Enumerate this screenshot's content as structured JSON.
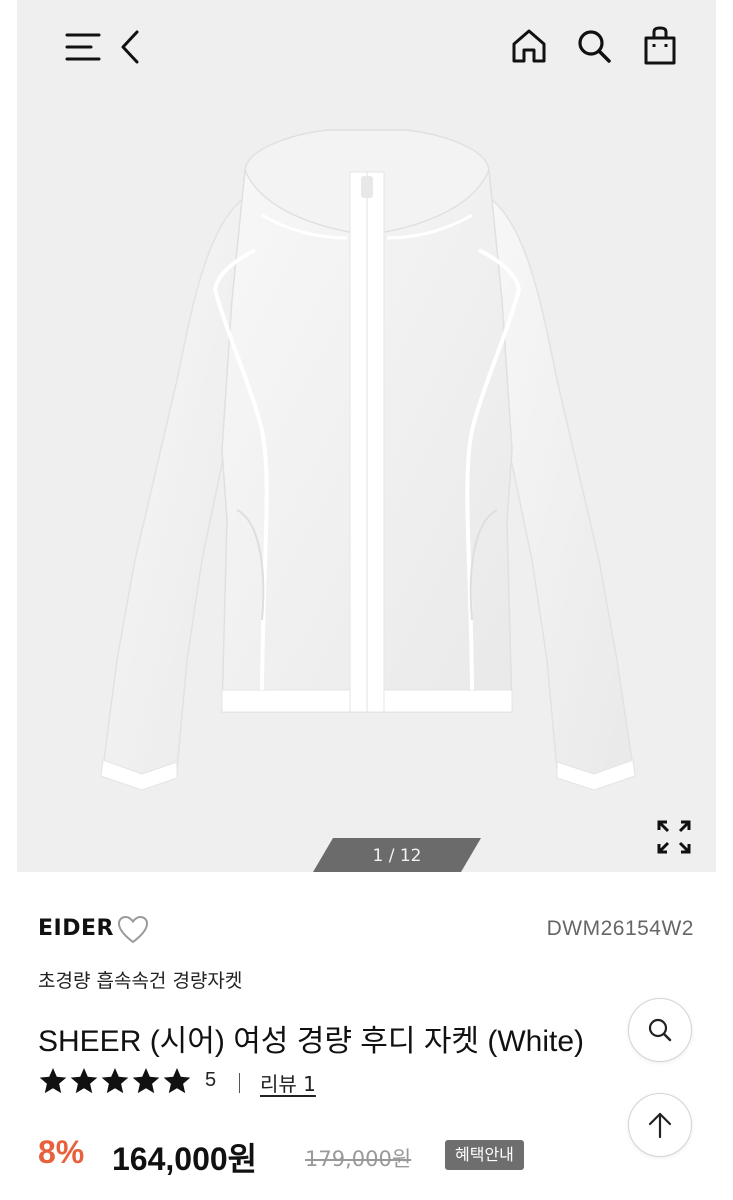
{
  "gallery": {
    "counter": "1 / 12",
    "current_page": 1,
    "total_pages": 12
  },
  "topbar": {
    "icons": [
      "menu-icon",
      "back-arrow-icon",
      "home-icon",
      "search-icon",
      "shopping-bag-icon"
    ]
  },
  "product": {
    "brand": "EIDER",
    "code": "DWM26154W2",
    "subtitle": "초경량 흡속속건 경량자켓",
    "title": "SHEER (시어) 여성 경량 후디 자켓 (White)",
    "rating": {
      "stars_filled": 5,
      "stars_total": 5,
      "score": "5",
      "review_label": "리뷰 1"
    },
    "price": {
      "discount": "8%",
      "sale": "164,000원",
      "original": "179,000원",
      "benefit_button": "혜택안내"
    }
  },
  "colors": {
    "discount": "#e8603c",
    "hero_background": "#efefef",
    "badge": "#6e6e6e"
  }
}
